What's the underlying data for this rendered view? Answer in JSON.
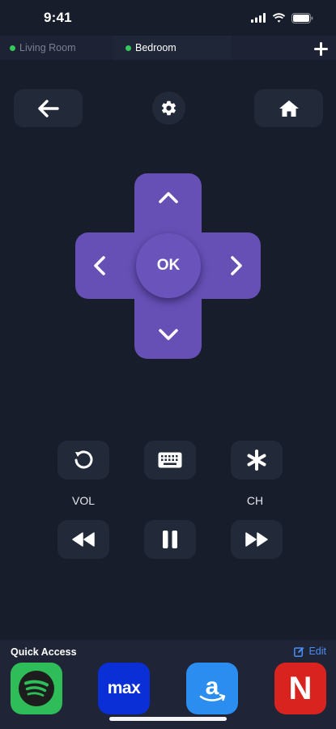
{
  "status_bar": {
    "time": "9:41",
    "icons": [
      "signal-icon",
      "wifi-icon",
      "battery-icon"
    ]
  },
  "device_tabs": [
    {
      "label": "Living Room",
      "status_color": "#35c95a",
      "active": false
    },
    {
      "label": "Bedroom",
      "status_color": "#35c95a",
      "active": true
    }
  ],
  "add_tab_icon": "plus-icon",
  "top_controls": {
    "back_icon": "arrow-left-icon",
    "settings_icon": "gear-icon",
    "home_icon": "home-icon"
  },
  "dpad": {
    "ok_label": "OK",
    "color": "#6650b6"
  },
  "media_controls": {
    "row1": [
      "replay-icon",
      "keyboard-icon",
      "asterisk-icon"
    ],
    "vol_label": "VOL",
    "ch_label": "CH",
    "row2": [
      "rewind-icon",
      "pause-icon",
      "fast-forward-icon"
    ]
  },
  "quick_access": {
    "title": "Quick Access",
    "edit_label": "Edit",
    "apps": [
      {
        "name": "spotify",
        "icon": "spotify-icon",
        "color": "#2ebd59"
      },
      {
        "name": "max",
        "text": "max",
        "color": "#0a2fd6"
      },
      {
        "name": "amazon",
        "icon": "amazon-icon",
        "color": "#2b8df0"
      },
      {
        "name": "netflix",
        "text": "N",
        "color": "#d8231f"
      }
    ]
  },
  "colors": {
    "background": "#181d2c",
    "button": "#222939",
    "accent": "#4a8ef5"
  }
}
